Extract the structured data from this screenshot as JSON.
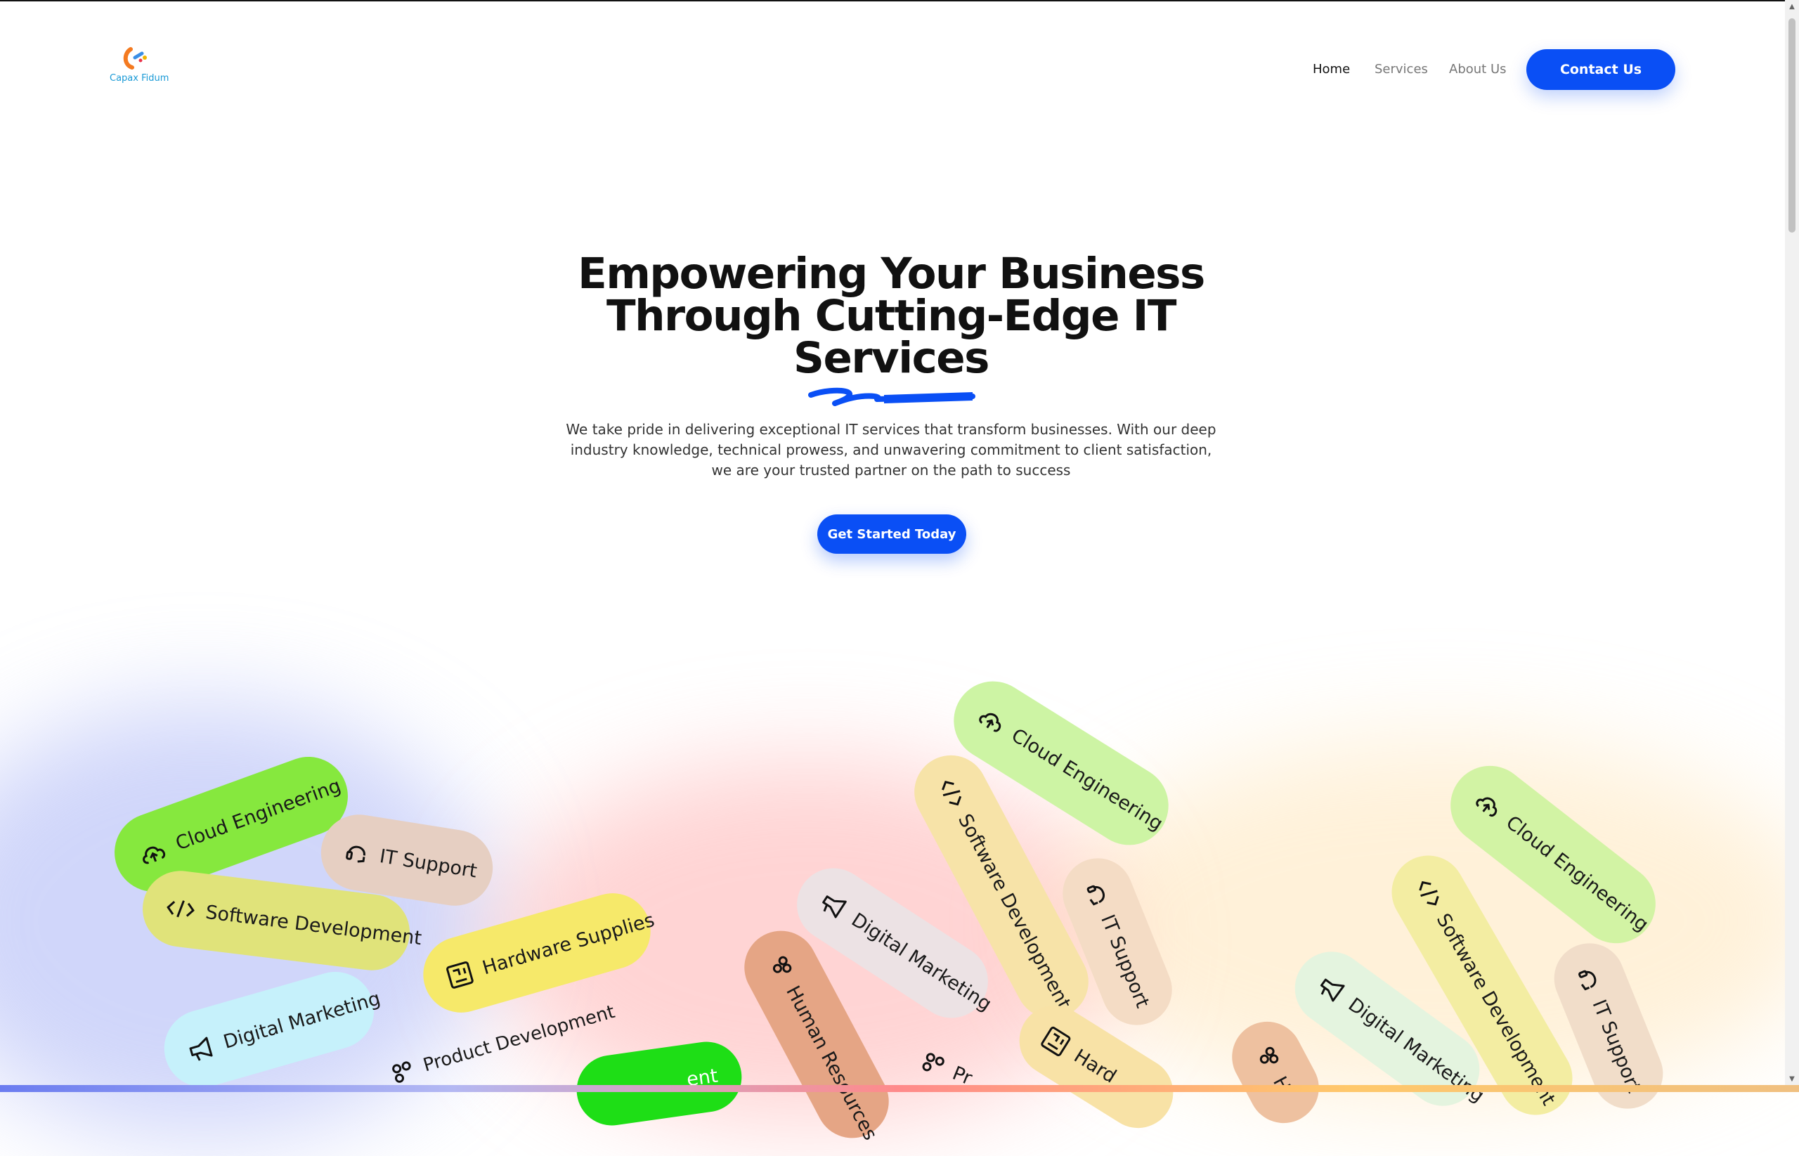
{
  "brand": {
    "name": "Capax Fidum"
  },
  "nav": {
    "items": [
      {
        "label": "Home",
        "active": true
      },
      {
        "label": "Services",
        "active": false
      },
      {
        "label": "About Us",
        "active": false
      }
    ],
    "contact_label": "Contact Us"
  },
  "hero": {
    "title_line1": "Empowering Your Business",
    "title_line2": "Through Cutting-Edge IT",
    "title_line3": "Services",
    "description": "We take pride in delivering exceptional IT services that transform businesses. With our deep industry knowledge, technical prowess, and unwavering commitment to client satisfaction, we are your trusted partner on the path to success",
    "cta_label": "Get Started Today"
  },
  "services": {
    "cloud": "Cloud Engineering",
    "support": "IT Support",
    "software": "Software Development",
    "hardware": "Hardware Supplies",
    "marketing": "Digital Marketing",
    "product": "Product Development",
    "hr": "Human Resources",
    "partial_ent": "ent",
    "partial_pr": "Pr",
    "partial_hard": "Hard",
    "partial_h": "H"
  },
  "colors": {
    "accent": "#0a4ff5"
  }
}
